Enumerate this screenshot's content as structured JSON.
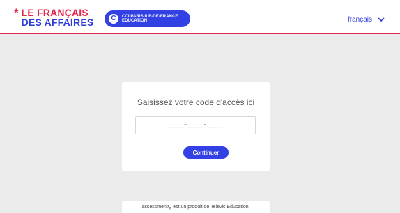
{
  "header": {
    "brand": {
      "star": "*",
      "line1": "LE FRANÇAIS",
      "line2": "DES AFFAIRES"
    },
    "cci": {
      "logo": "C",
      "line1": "CCI PARIS ILE-DE-FRANCE",
      "line2": "EDUCATION"
    },
    "language": {
      "selected": "français",
      "icon": "chevron-down-icon"
    }
  },
  "card": {
    "title": "Saisissez votre code d'accès ici",
    "code_value": "___-___-___",
    "button_label": "Continuer"
  },
  "footer": {
    "text": "assessmentQ est un produit de Televic Education."
  },
  "colors": {
    "brand_red": "#e6264b",
    "brand_blue": "#3340e3",
    "background": "#ebebeb"
  }
}
